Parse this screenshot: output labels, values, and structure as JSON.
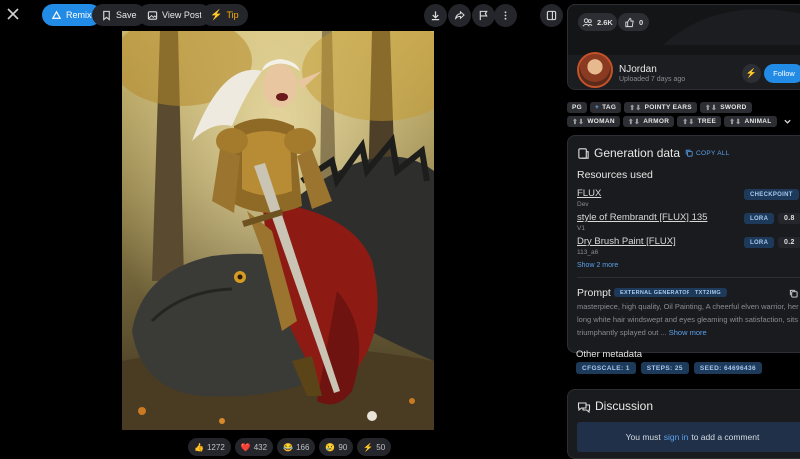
{
  "toolbar": {
    "remix_label": "Remix",
    "save_label": "Save",
    "view_post_label": "View Post",
    "tip_label": "Tip"
  },
  "reactions": [
    {
      "emoji": "👍",
      "count": "1272"
    },
    {
      "emoji": "❤️",
      "count": "432"
    },
    {
      "emoji": "😂",
      "count": "166"
    },
    {
      "emoji": "😢",
      "count": "90"
    },
    {
      "emoji": "⚡",
      "count": "50"
    }
  ],
  "stats": {
    "collected": "2.6K",
    "likes": "0"
  },
  "user": {
    "name": "NJordan",
    "uploaded": "Uploaded 7 days ago",
    "follow_label": "Follow"
  },
  "tags": {
    "rating": "PG",
    "add_label": "TAG",
    "row1": [
      "POINTY EARS",
      "SWORD"
    ],
    "row2": [
      "WOMAN",
      "ARMOR",
      "TREE",
      "ANIMAL"
    ]
  },
  "generation": {
    "title": "Generation data",
    "copy_all": "COPY ALL",
    "resources_title": "Resources used",
    "resources": [
      {
        "name": "FLUX",
        "sub": "Dev",
        "type": "CHECKPOINT",
        "weight": ""
      },
      {
        "name": "style of Rembrandt [FLUX] 135",
        "sub": "V1",
        "type": "LORA",
        "weight": "0.8"
      },
      {
        "name": "Dry Brush Paint [FLUX]",
        "sub": "113_a6",
        "type": "LORA",
        "weight": "0.2"
      }
    ],
    "show_more_resources": "Show 2 more",
    "prompt_title": "Prompt",
    "prompt_badges": [
      "EXTERNAL GENERATOR",
      "TXT2IMG"
    ],
    "prompt_text": "masterpiece, high quality, Oil Painting, A cheerful elven warrior, her long white hair windswept and eyes gleaming with satisfaction, sits triumphantly splayed out ...",
    "prompt_show_more": "Show more",
    "other_meta_title": "Other metadata",
    "meta": [
      "CFGSCALE: 1",
      "STEPS: 25",
      "SEED: 64696436"
    ]
  },
  "discussion": {
    "title": "Discussion",
    "must_prefix": "You must",
    "sign_in": "sign in",
    "must_suffix": "to add a comment"
  },
  "colors": {
    "accent": "#228be6",
    "tip": "#fab005",
    "panel": "#1a1b1e",
    "badge_bg": "#1e3a5a"
  }
}
